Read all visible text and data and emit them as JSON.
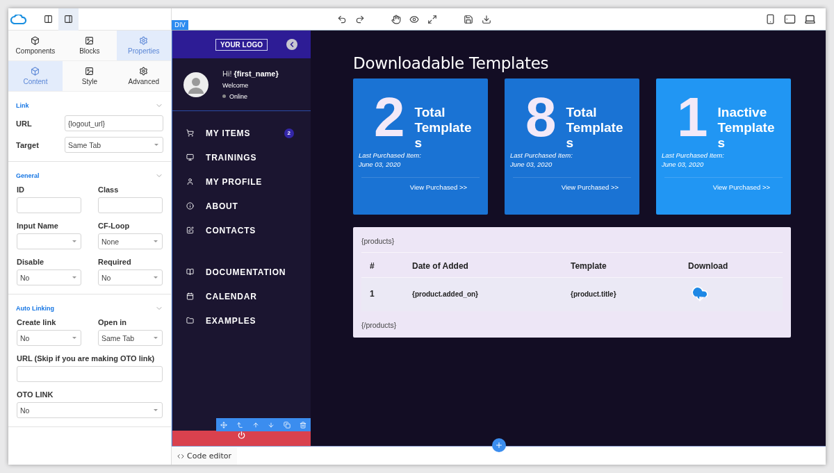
{
  "panel": {
    "tabs": [
      {
        "label": "Components",
        "selected": false
      },
      {
        "label": "Blocks",
        "selected": false
      },
      {
        "label": "Properties",
        "selected": true
      }
    ],
    "subtabs": [
      {
        "label": "Content",
        "selected": true
      },
      {
        "label": "Style",
        "selected": false
      },
      {
        "label": "Advanced",
        "selected": false
      }
    ],
    "sections": [
      {
        "title": "Link",
        "kind": "inline",
        "fields": [
          {
            "label": "URL",
            "kind": "text",
            "value": "{logout_url}"
          },
          {
            "label": "Target",
            "kind": "select",
            "value": "Same Tab"
          }
        ]
      },
      {
        "title": "General",
        "kind": "grid",
        "fields": [
          {
            "label": "ID",
            "kind": "text"
          },
          {
            "label": "Class",
            "kind": "text"
          },
          {
            "label": "Input Name",
            "kind": "select"
          },
          {
            "label": "CF-Loop",
            "kind": "select",
            "value": "None"
          },
          {
            "label": "Disable",
            "kind": "select",
            "value": "No"
          },
          {
            "label": "Required",
            "kind": "select",
            "value": "No"
          }
        ]
      },
      {
        "title": "Auto Linking",
        "kind": "grid",
        "fields": [
          {
            "label": "Create link",
            "kind": "select",
            "value": "No"
          },
          {
            "label": "Open in",
            "kind": "select",
            "value": "Same Tab"
          },
          {
            "label": "URL (Skip if you are making OTO link)",
            "kind": "wide-text"
          },
          {
            "label": "OTO LINK",
            "kind": "wide-select",
            "value": "No"
          }
        ]
      }
    ]
  },
  "canvas": {
    "tag": "DIV",
    "bottom_tab": "Code editor",
    "sidebar": {
      "logo": "YOUR LOGO",
      "greeting": "Hi! ",
      "name": "{first_name}",
      "welcome": "Welcome",
      "status": "Online",
      "nav_groups": [
        [
          {
            "label": "MY ITEMS",
            "badge": "2"
          },
          {
            "label": "TRAININGS"
          },
          {
            "label": "MY PROFILE"
          },
          {
            "label": "ABOUT"
          },
          {
            "label": "CONTACTS"
          }
        ],
        [
          {
            "label": "DOCUMENTATION"
          },
          {
            "label": "CALENDAR"
          },
          {
            "label": "EXAMPLES"
          }
        ]
      ]
    },
    "heading": "Downloadable Templates",
    "cards": [
      {
        "number": "2",
        "title": "Total Templates",
        "caption": "Last Purchased Item:",
        "date": "June 03, 2020",
        "link": "View Purchased >>",
        "color": "#1a73d4"
      },
      {
        "number": "8",
        "title": "Total Templates",
        "caption": "Last Purchased Item:",
        "date": "June 03, 2020",
        "link": "View Purchased >>",
        "color": "#1a73d4"
      },
      {
        "number": "1",
        "title": "Inactive Templates",
        "caption": "Last Purchased Item:",
        "date": "June 03, 2020",
        "link": "View Purchased >>",
        "color": "#2196f3"
      }
    ],
    "table": {
      "open_tag": "{products}",
      "close_tag": "{/products}",
      "columns": [
        "#",
        "Date of Added",
        "Template",
        "Download"
      ],
      "rows": [
        {
          "cells": [
            "1",
            "{product.added_on}",
            "{product.title}"
          ]
        }
      ]
    }
  }
}
